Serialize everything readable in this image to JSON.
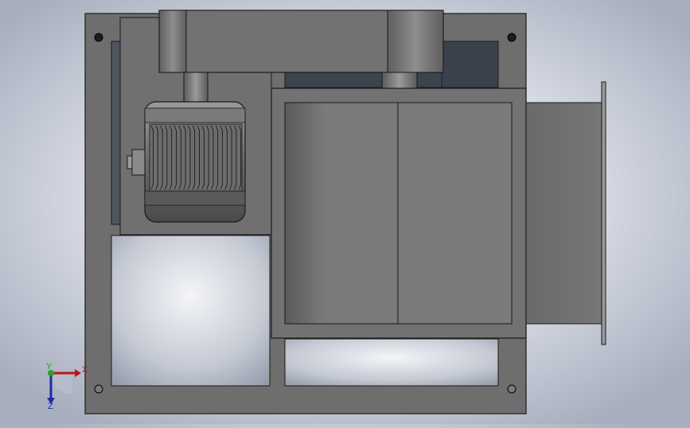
{
  "viewport": {
    "description_view": "front",
    "background_top": "#a7aebd",
    "background_center": "#ffffff"
  },
  "colors": {
    "frame": "#6e6e6e",
    "frame_dark": "#5c5c5c",
    "edge": "#1a1a1a",
    "housing": "#727272",
    "opening_shadow": "#3d4450",
    "axis_x": "#c0141c",
    "axis_y": "#2aa02a",
    "axis_z": "#1c2ca8"
  },
  "triad": {
    "x_label": "X",
    "y_label": "Y",
    "z_label": "Z"
  }
}
